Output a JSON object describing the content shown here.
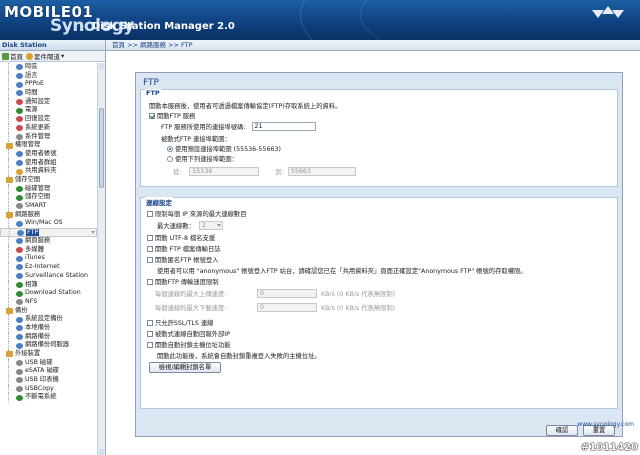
{
  "banner": {
    "logo": "MOBILE01",
    "brand": "Synology",
    "title": "Disk Station Manager 2.0"
  },
  "left": {
    "header": "Disk Station",
    "home": "首頁",
    "manage": "套件閘道",
    "tree": [
      {
        "label": "時區",
        "level": 2,
        "color": "#4a7fc1"
      },
      {
        "label": "語言",
        "level": 2,
        "color": "#4a7fc1"
      },
      {
        "label": "PPPoE",
        "level": 2,
        "color": "#4a7fc1"
      },
      {
        "label": "時間",
        "level": 2,
        "color": "#4a7fc1"
      },
      {
        "label": "通知設定",
        "level": 2,
        "color": "#c84a4a"
      },
      {
        "label": "電源",
        "level": 2,
        "color": "#2d8a2d"
      },
      {
        "label": "回復設定",
        "level": 2,
        "color": "#c84a4a"
      },
      {
        "label": "系統更新",
        "level": 2,
        "color": "#c84a4a"
      },
      {
        "label": "系件管理",
        "level": 2,
        "color": "#888888"
      },
      {
        "label": "權限管理",
        "level": 1,
        "color": "#d9a02a"
      },
      {
        "label": "使用者帳號",
        "level": 2,
        "color": "#4a7fc1"
      },
      {
        "label": "使用者群組",
        "level": 2,
        "color": "#4a7fc1"
      },
      {
        "label": "共用資料夾",
        "level": 2,
        "color": "#d9a02a"
      },
      {
        "label": "儲存空間",
        "level": 1,
        "color": "#d9a02a"
      },
      {
        "label": "磁碟管理",
        "level": 2,
        "color": "#2d8a2d"
      },
      {
        "label": "儲存空間",
        "level": 2,
        "color": "#2d8a2d"
      },
      {
        "label": "SMART",
        "level": 2,
        "color": "#888888"
      },
      {
        "label": "網路服務",
        "level": 1,
        "color": "#d9a02a"
      },
      {
        "label": "Win/Mac OS",
        "level": 2,
        "color": "#4a7fc1"
      },
      {
        "label": "FTP",
        "level": 2,
        "color": "#4a7fc1",
        "selected": true
      },
      {
        "label": "網頁服務",
        "level": 2,
        "color": "#4a7fc1"
      },
      {
        "label": "多媒體",
        "level": 2,
        "color": "#c84a4a"
      },
      {
        "label": "iTunes",
        "level": 2,
        "color": "#4a7fc1"
      },
      {
        "label": "Ez-Internet",
        "level": 2,
        "color": "#4a7fc1"
      },
      {
        "label": "Surveillance Station",
        "level": 2,
        "color": "#4a7fc1"
      },
      {
        "label": "相簿",
        "level": 2,
        "color": "#2d8a2d"
      },
      {
        "label": "Download Station",
        "level": 2,
        "color": "#2d8a2d"
      },
      {
        "label": "NFS",
        "level": 2,
        "color": "#888888"
      },
      {
        "label": "備份",
        "level": 1,
        "color": "#d9a02a"
      },
      {
        "label": "系統設定備份",
        "level": 2,
        "color": "#4a7fc1"
      },
      {
        "label": "本地備份",
        "level": 2,
        "color": "#4a7fc1"
      },
      {
        "label": "網路備份",
        "level": 2,
        "color": "#4a7fc1"
      },
      {
        "label": "網路備份伺服器",
        "level": 2,
        "color": "#4a7fc1"
      },
      {
        "label": "外接裝置",
        "level": 1,
        "color": "#d9a02a"
      },
      {
        "label": "USB 磁碟",
        "level": 2,
        "color": "#888888"
      },
      {
        "label": "eSATA 磁碟",
        "level": 2,
        "color": "#888888"
      },
      {
        "label": "USB 印表機",
        "level": 2,
        "color": "#888888"
      },
      {
        "label": "USBCopy",
        "level": 2,
        "color": "#888888"
      },
      {
        "label": "不斷電系統",
        "level": 2,
        "color": "#2d8a2d"
      }
    ]
  },
  "breadcrumb": "首頁 >> 網路服務 >> FTP",
  "panel": {
    "title": "FTP",
    "ftp_legend": "FTP",
    "intro": "開動本服務後，使用者可透過檔案傳輸協定(FTP)存取系統上的資料。",
    "enable_ftp": "開動FTP 服務",
    "max_conn_label": "FTP 服務所使用的連接埠號碼:",
    "max_conn_value": "21",
    "passive_label": "被動式FTP 連接埠範圍：",
    "passive_default": "使用預設連接埠範圍 (55536-55663)",
    "passive_custom": "使用下列連接埠範圍：",
    "from_label": "從:",
    "from_value": "55536",
    "to_label": "到:",
    "to_value": "55663",
    "adv_legend": "連線設定",
    "limit_ip": "限制每個 IP 來源的最大連線數目",
    "max_ip_label": "最大連線數：",
    "max_ip_value": "2",
    "utf8": "開動 UTF-8 檔名支援",
    "log": "開動 FTP 檔案傳輸日誌",
    "anon": "開動匿名FTP 帳號登入",
    "anon_note": "使用者可以用 \"anonymous\" 帳號登入FTP 站台，請確認您已在「共用資料夾」頁面正確設定\"Anonymous FTP\" 帳號的存取權限。",
    "speed_limit": "開動FTP 傳輸速度限制",
    "up_label": "每個連線的最大上傳速度:",
    "up_value": "0",
    "up_unit": "KB/s (0 KB/s 代表無限制)",
    "down_label": "每個連線的最大下載速度:",
    "down_value": "0",
    "down_unit": "KB/s (0 KB/s 代表無限制)",
    "ssl": "只允許SSL/TLS 連線",
    "pasv_ip": "被動式連線自動回報外部IP",
    "fxp": "開動自動封鎖主機位址功能",
    "fxp_note": "開動此功能後，系統會自動封鎖重複登入失敗的主機位址。",
    "blocklist_btn": "檢視/編輯封鎖名單",
    "ok_btn": "確認",
    "reset_btn": "重置"
  },
  "footer_url": "www.synology.com",
  "watermark": "#1011420"
}
